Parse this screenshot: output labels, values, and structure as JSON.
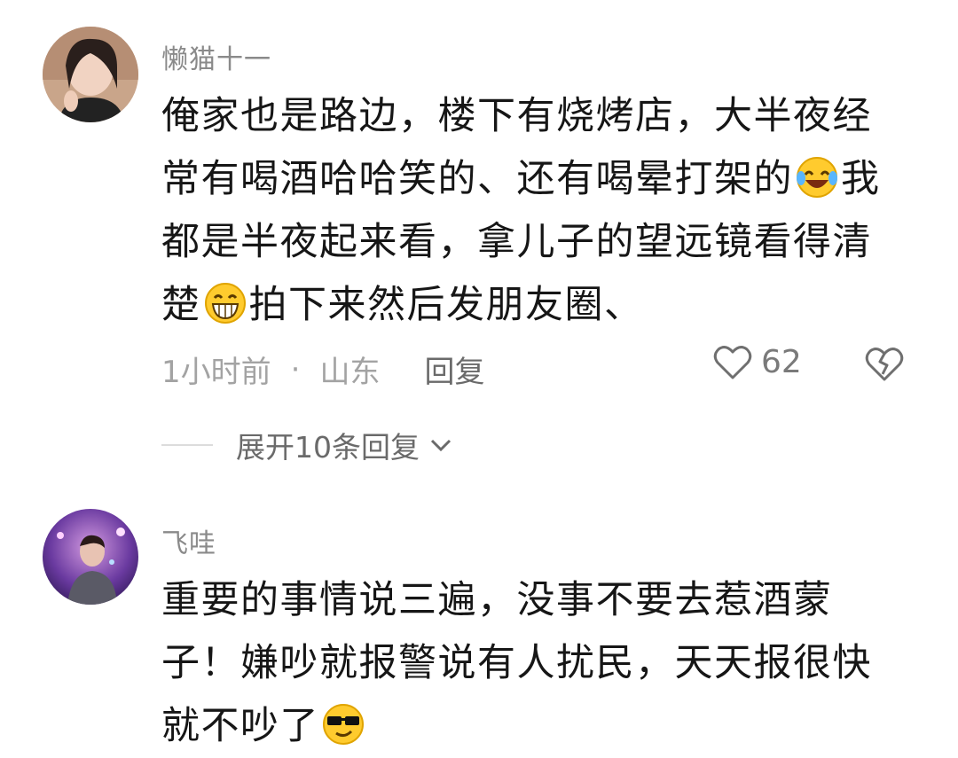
{
  "comments": [
    {
      "username": "懒猫十一",
      "lines": [
        [
          "俺家也是路边，楼下有烧烤店，大半夜经"
        ],
        [
          "常有喝酒哈哈笑的、还有喝晕打架的",
          "我"
        ],
        [
          "都是半夜起来看，拿儿子的望远镜看得清"
        ],
        [
          "楚",
          "拍下来然后发朋友圈、"
        ]
      ],
      "emojis": [
        "laughing-emoji",
        "grinning-emoji"
      ],
      "time": "1小时前",
      "separator": "·",
      "location": "山东",
      "reply_label": "回复",
      "like_count": "62",
      "expand_label": "展开10条回复"
    },
    {
      "username": "飞哇",
      "lines": [
        [
          "重要的事情说三遍，没事不要去惹酒蒙"
        ],
        [
          "子！嫌吵就报警说有人扰民，天天报很快"
        ],
        [
          "就不吵了"
        ]
      ],
      "emojis": [
        "sunglasses-emoji"
      ]
    }
  ],
  "colors": {
    "text": "#161616",
    "username": "#8a8a8a",
    "meta": "#a3a3a3",
    "action": "#6a6a6a"
  }
}
